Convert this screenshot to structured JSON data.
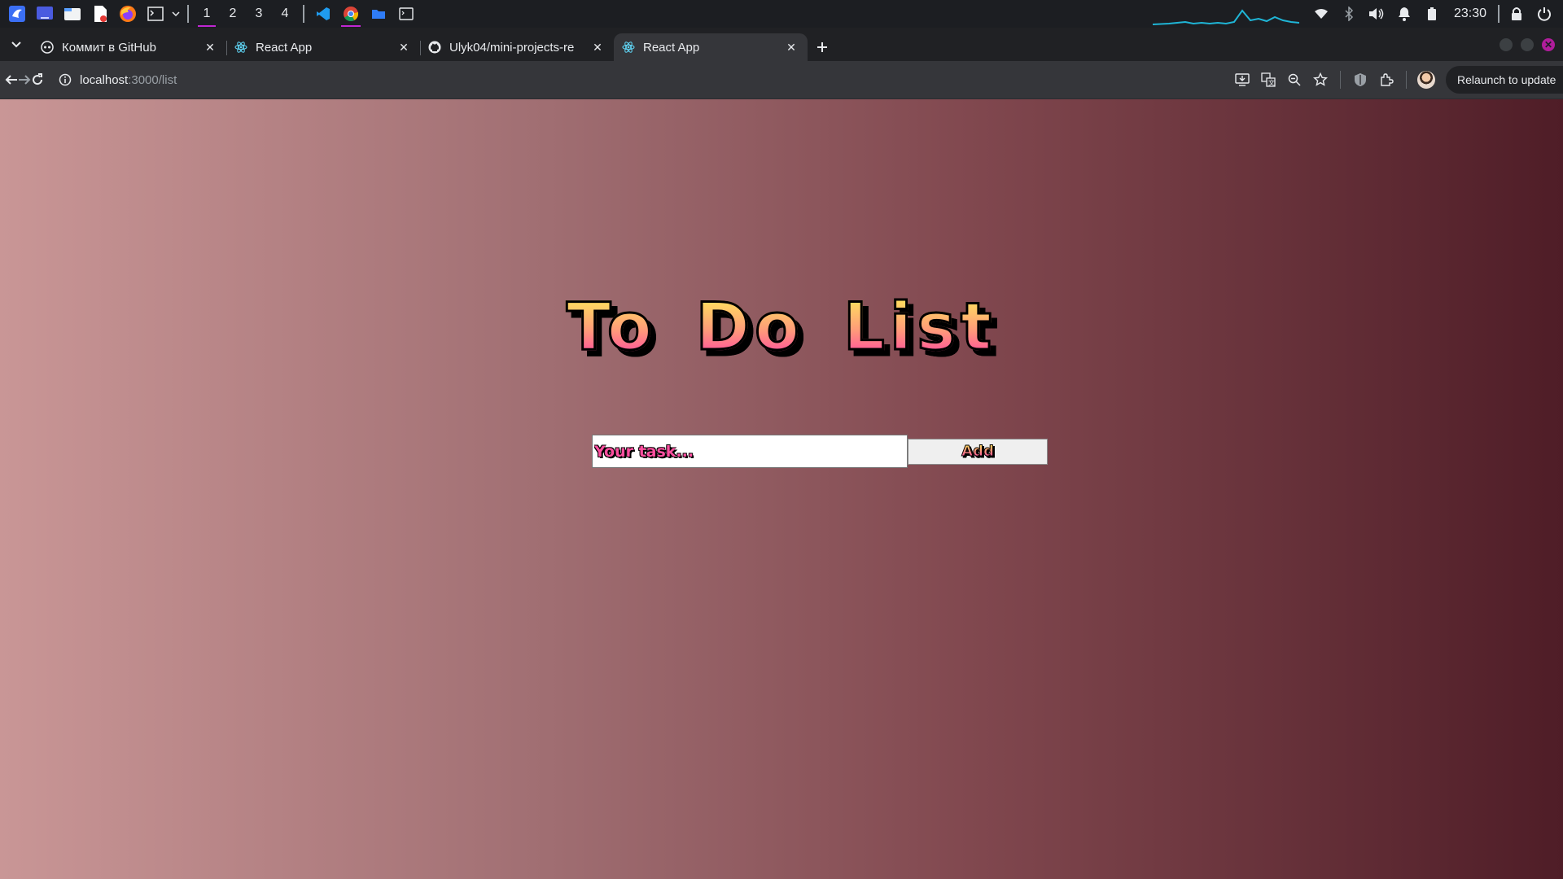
{
  "taskbar": {
    "workspaces": [
      "1",
      "2",
      "3",
      "4"
    ],
    "active_workspace": "1",
    "clock": "23:30",
    "icons": [
      "app-launcher-icon",
      "desktop-icon",
      "files-icon",
      "document-icon",
      "firefox-icon",
      "terminal-icon",
      "vscode-icon",
      "chrome-icon",
      "folder-icon",
      "terminal-window-icon"
    ],
    "tray_icons": [
      "wifi-icon",
      "bluetooth-icon",
      "volume-icon",
      "bell-icon",
      "battery-icon",
      "lock-icon",
      "power-icon"
    ]
  },
  "tabs": [
    {
      "title": "Коммит в GitHub",
      "favicon": "github-copilot-icon",
      "active": false
    },
    {
      "title": "React App",
      "favicon": "react-icon",
      "active": false
    },
    {
      "title": "Ulyk04/mini-projects-re",
      "favicon": "github-icon",
      "active": false
    },
    {
      "title": "React App",
      "favicon": "react-icon",
      "active": true
    }
  ],
  "toolbar": {
    "url_host": "localhost",
    "url_path": ":3000/list",
    "relaunch_label": "Relaunch to update"
  },
  "page": {
    "title": "To Do List",
    "input_placeholder": "Your task...",
    "input_value": "",
    "add_label": "Add"
  },
  "colors": {
    "gradient_start": "#c99696",
    "gradient_end": "#4f1d27",
    "title_yellow": "#ffe55c",
    "title_pink": "#ff3ea5",
    "accent_purple": "#c026d3"
  }
}
